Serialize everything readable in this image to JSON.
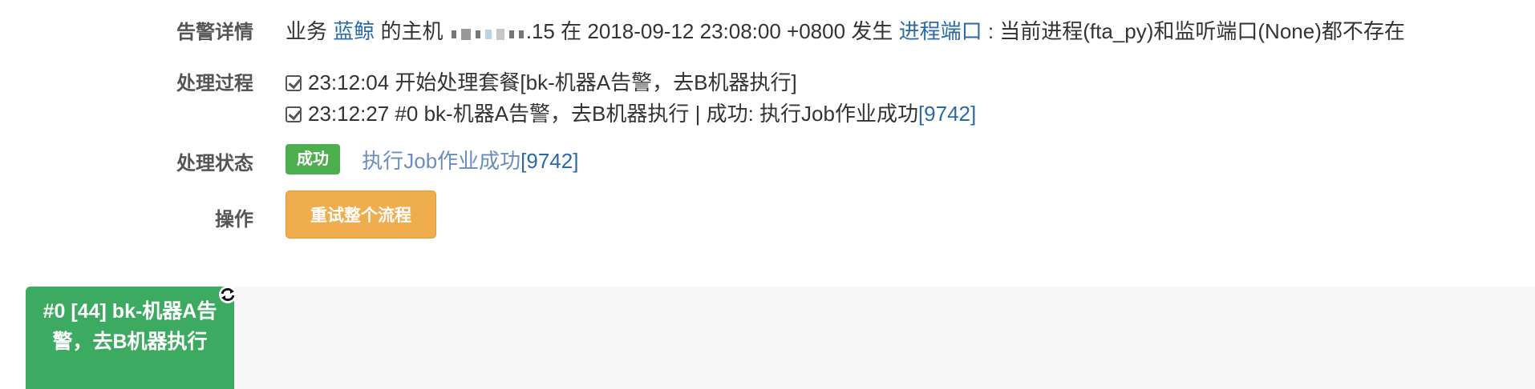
{
  "alarm_detail": {
    "label": "告警详情",
    "prefix": "业务",
    "business": "蓝鲸",
    "host_prefix": "的主机",
    "host_suffix": ".15",
    "in": "在",
    "time": "2018-09-12 23:08:00 +0800",
    "happen": "发生",
    "alarm_type": "进程端口",
    "description": ": 当前进程(fta_py)和监听端口(None)都不存在"
  },
  "process": {
    "label": "处理过程",
    "steps": [
      "23:12:04 开始处理套餐[bk-机器A告警，去B机器执行]",
      "23:12:27 #0 bk-机器A告警，去B机器执行 | 成功: 执行Job作业成功"
    ],
    "step2_link": "[9742]"
  },
  "status": {
    "label": "处理状态",
    "badge": "成功",
    "link_text": "执行Job作业成功",
    "link_num": "[9742]"
  },
  "operation": {
    "label": "操作",
    "retry_button": "重试整个流程"
  },
  "flow": {
    "node_label": "#0 [44] bk-机器A告警，去B机器执行",
    "node_color": "#3daa62",
    "icon": "refresh-icon"
  }
}
